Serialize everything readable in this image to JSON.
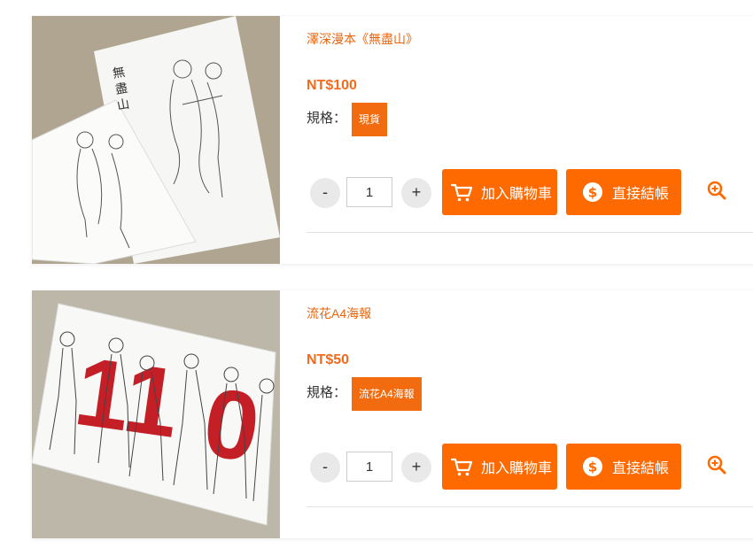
{
  "products": [
    {
      "title": "澤深漫本《無盡山》",
      "price": "NT$100",
      "spec_label": "規格：",
      "spec_option": "現貨",
      "qty_minus": "-",
      "qty_value": "1",
      "qty_plus": "+",
      "add_to_cart": "加入購物車",
      "checkout": "直接結帳",
      "image_icon": "comic-book-photo"
    },
    {
      "title": "流花A4海報",
      "price": "NT$50",
      "spec_label": "規格：",
      "spec_option": "流花A4海報",
      "qty_minus": "-",
      "qty_value": "1",
      "qty_plus": "+",
      "add_to_cart": "加入購物車",
      "checkout": "直接結帳",
      "image_icon": "poster-photo"
    }
  ],
  "colors": {
    "accent": "#ff6a00",
    "title": "#e8650f",
    "price": "#f26b1d"
  }
}
